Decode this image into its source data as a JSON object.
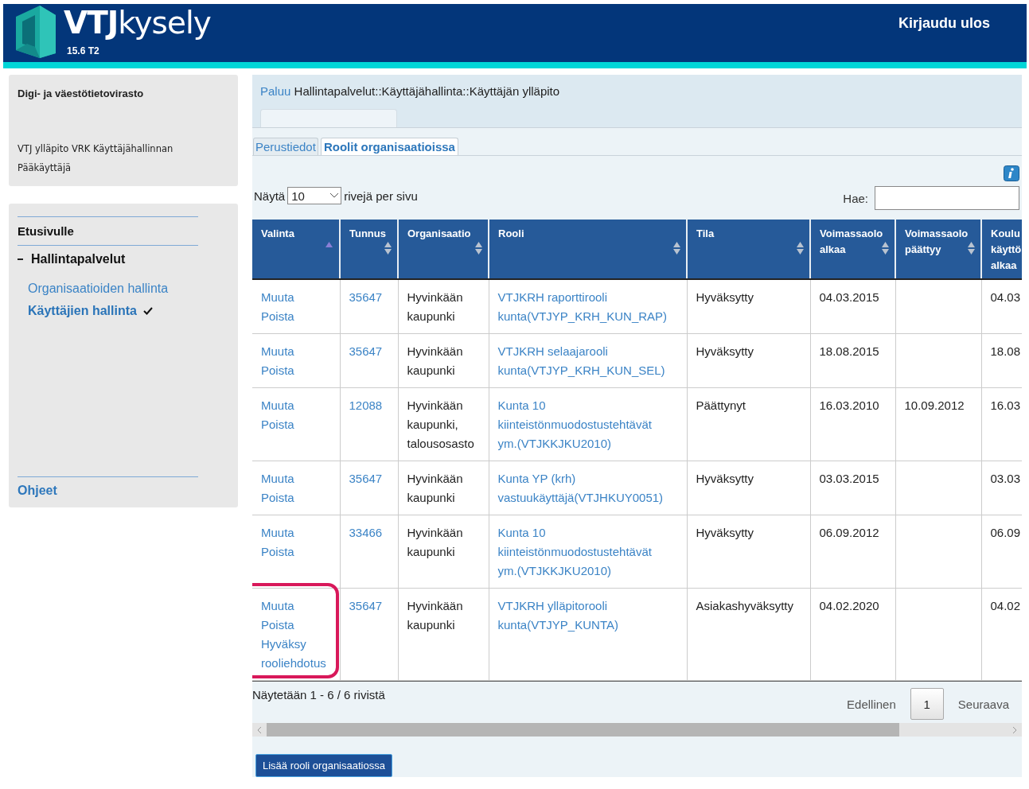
{
  "header": {
    "logo_bold": "VTJ",
    "logo_light": "kysely",
    "version": "15.6 T2",
    "logout": "Kirjaudu ulos"
  },
  "user_card": {
    "organization": "Digi- ja väestötietovirasto",
    "role": "VTJ ylläpito VRK Käyttäjähallinnan Pääkäyttäjä"
  },
  "nav": [
    {
      "kind": "top",
      "label": "Etusivulle"
    },
    {
      "kind": "group",
      "label": "Hallintapalvelut",
      "expanded": true,
      "children": [
        {
          "label": "Organisaatioiden hallinta",
          "selected": false
        },
        {
          "label": "Käyttäjien hallinta",
          "selected": true
        }
      ]
    }
  ],
  "help_link": "Ohjeet",
  "breadcrumb": {
    "back": "Paluu",
    "path": "Hallintapalvelut::Käyttäjähallinta::Käyttäjän ylläpito"
  },
  "tabs": [
    {
      "label": "Perustiedot",
      "selected": false
    },
    {
      "label": "Roolit organisaatioissa",
      "selected": true
    }
  ],
  "page_length": {
    "label_before": "Näytä",
    "value": "10",
    "label_after": "rivejä per sivu"
  },
  "search": {
    "label": "Hae:"
  },
  "table": {
    "columns": [
      {
        "label": [
          "Valinta"
        ],
        "sortable": true,
        "sorted": true
      },
      {
        "label": [
          "Tunnus"
        ],
        "sortable": true,
        "sorted": false
      },
      {
        "label": [
          "Organisaatio"
        ],
        "sortable": true,
        "sorted": false
      },
      {
        "label": [
          "Rooli"
        ],
        "sortable": true,
        "sorted": false
      },
      {
        "label": [
          "Tila"
        ],
        "sortable": true,
        "sorted": false
      },
      {
        "label": [
          "Voimassaolo",
          "alkaa"
        ],
        "sortable": true,
        "sorted": false
      },
      {
        "label": [
          "Voimassaolo",
          "päättyy"
        ],
        "sortable": true,
        "sorted": false
      },
      {
        "label": [
          "Koulu",
          "käyttö",
          "alkaa"
        ]
      }
    ],
    "rows": [
      {
        "actions": [
          "Muuta",
          "Poista"
        ],
        "id": "35647",
        "organization": [
          "Hyvinkään",
          "kaupunki"
        ],
        "role": [
          "VTJKRH raporttirooli",
          "kunta(VTJYP_KRH_KUN_RAP)"
        ],
        "status": "Hyväksytty",
        "start": "04.03.2015",
        "column_8": "04.03",
        "highlighted": false
      },
      {
        "actions": [
          "Muuta",
          "Poista"
        ],
        "id": "35647",
        "organization": [
          "Hyvinkään",
          "kaupunki"
        ],
        "role": [
          "VTJKRH selaajarooli",
          "kunta(VTJYP_KRH_KUN_SEL)"
        ],
        "status": "Hyväksytty",
        "start": "18.08.2015",
        "column_8": "18.08",
        "highlighted": false
      },
      {
        "actions": [
          "Muuta",
          "Poista"
        ],
        "id": "12088",
        "organization": [
          "Hyvinkään",
          "kaupunki,",
          "talousosasto"
        ],
        "role": [
          "Kunta 10",
          "kiinteistönmuodostustehtävät",
          "ym.(VTJKKJKU2010)"
        ],
        "status": "Päättynyt",
        "start": "16.03.2010",
        "end": "10.09.2012",
        "column_8": "16.03",
        "highlighted": false
      },
      {
        "actions": [
          "Muuta",
          "Poista"
        ],
        "id": "35647",
        "organization": [
          "Hyvinkään",
          "kaupunki"
        ],
        "role": [
          "Kunta YP (krh)",
          "vastuukäyttäjä(VTJHKUY0051)"
        ],
        "status": "Hyväksytty",
        "start": "03.03.2015",
        "column_8": "03.03",
        "highlighted": false
      },
      {
        "actions": [
          "Muuta",
          "Poista"
        ],
        "id": "33466",
        "organization": [
          "Hyvinkään",
          "kaupunki"
        ],
        "role": [
          "Kunta 10",
          "kiinteistönmuodostustehtävät",
          "ym.(VTJKKJKU2010)"
        ],
        "status": "Hyväksytty",
        "start": "06.09.2012",
        "column_8": "06.09",
        "highlighted": false
      },
      {
        "actions": [
          "Muuta",
          "Poista",
          "Hyväksy rooliehdotus"
        ],
        "id": "35647",
        "organization": [
          "Hyvinkään",
          "kaupunki"
        ],
        "role": [
          "VTJKRH ylläpitorooli",
          "kunta(VTJYP_KUNTA)"
        ],
        "status": "Asiakashyväksytty",
        "start": "04.02.2020",
        "column_8": "04.02",
        "highlighted": true
      }
    ]
  },
  "pagination": {
    "info": "Näytetään 1 - 6 / 6 rivistä",
    "previous": "Edellinen",
    "pages": [
      {
        "label": "1",
        "selected": true
      }
    ],
    "next": "Seuraava"
  },
  "add_button": "Lisää rooli organisaatiossa"
}
